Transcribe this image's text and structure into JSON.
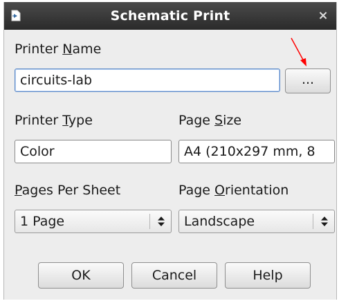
{
  "dialog": {
    "title": "Schematic Print",
    "app_icon": "document-icon",
    "close_icon": "close-icon",
    "close_glyph": "×"
  },
  "printer_name": {
    "label_pre": "Printer ",
    "label_mnemonic": "N",
    "label_post": "ame",
    "value": "circuits-lab",
    "browse_label": "..."
  },
  "printer_type": {
    "label_pre": "Printer ",
    "label_mnemonic": "T",
    "label_post": "ype",
    "value": "Color"
  },
  "page_size": {
    "label_pre": "Page ",
    "label_mnemonic": "S",
    "label_post": "ize",
    "value": "A4 (210x297 mm, 8"
  },
  "pages_per_sheet": {
    "label_pre": "",
    "label_mnemonic": "P",
    "label_post": "ages Per Sheet",
    "selected": "1 Page"
  },
  "page_orientation": {
    "label_pre": "Page ",
    "label_mnemonic": "O",
    "label_post": "rientation",
    "selected": "Landscape"
  },
  "buttons": {
    "ok": "OK",
    "cancel": "Cancel",
    "help": "Help"
  },
  "colors": {
    "annotation_arrow": "#ff0000",
    "titlebar": "#2a2a2a",
    "focus_border": "#5b88c7"
  }
}
